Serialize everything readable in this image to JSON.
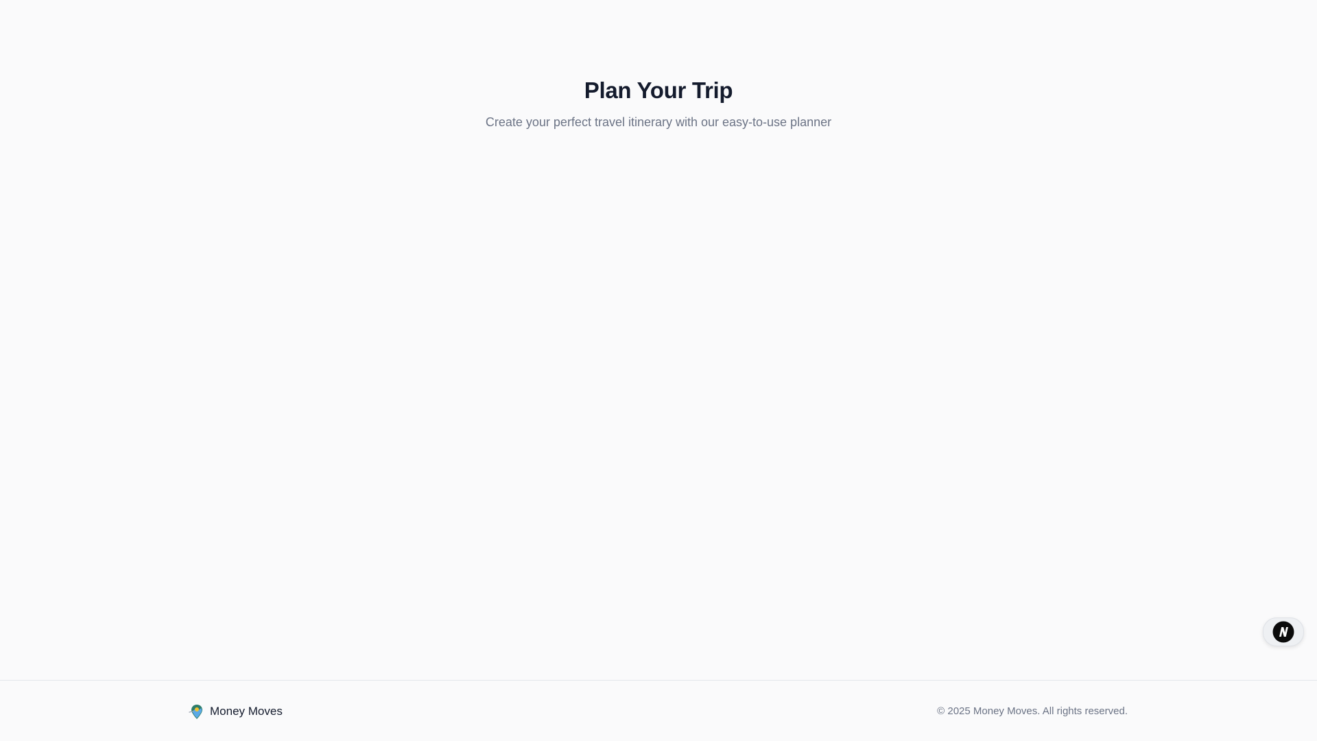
{
  "hero": {
    "title": "Plan Your Trip",
    "subtitle": "Create your perfect travel itinerary with our easy-to-use planner"
  },
  "floating_widget": {
    "icon": "n-logo-icon"
  },
  "footer": {
    "brand_name": "Money Moves",
    "brand_icon": "map-pin-icon",
    "copyright": "© 2025 Money Moves. All rights reserved."
  },
  "colors": {
    "background": "#fafafb",
    "heading": "#141b2d",
    "muted_text": "#6b7385",
    "divider": "#e3e6ea"
  }
}
